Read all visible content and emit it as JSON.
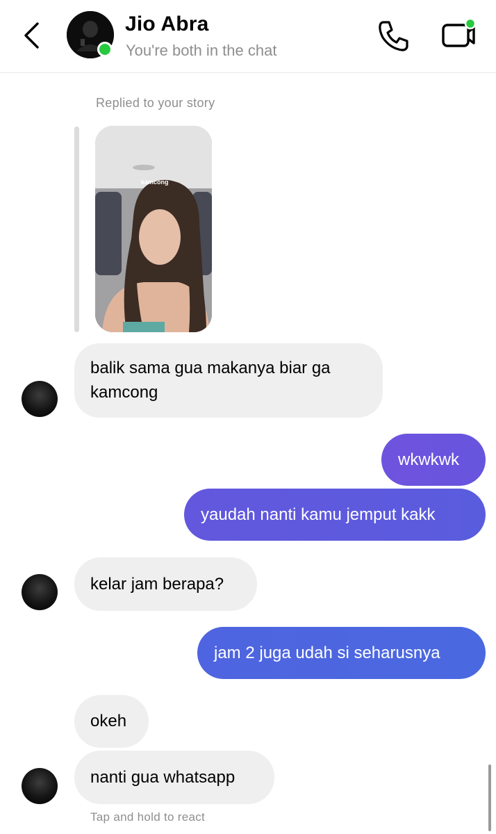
{
  "header": {
    "name": "Jio Abra",
    "status": "You're both in the chat"
  },
  "story": {
    "label": "Replied to your story",
    "caption": "kamcong"
  },
  "messages": [
    {
      "from": "them",
      "text_lines": [
        "balik sama gua makanya biar ga",
        "kamcong"
      ]
    },
    {
      "from": "me",
      "text": "wkwkwk"
    },
    {
      "from": "me",
      "text": "yaudah nanti kamu jemput kakk"
    },
    {
      "from": "them",
      "text": "kelar jam berapa?"
    },
    {
      "from": "me",
      "text": "jam 2 juga udah si seharusnya"
    },
    {
      "from": "them",
      "text": "okeh"
    },
    {
      "from": "them",
      "text": "nanti gua whatsapp"
    }
  ],
  "footer": {
    "hint": "Tap and hold to react"
  },
  "icons": {
    "back": "chevron-left-icon",
    "call": "phone-icon",
    "video": "video-camera-icon"
  },
  "colors": {
    "online": "#27c93f",
    "incoming_bubble": "#efefef",
    "outgoing_gradient": [
      "#6b51dd",
      "#4a6ae0"
    ]
  }
}
